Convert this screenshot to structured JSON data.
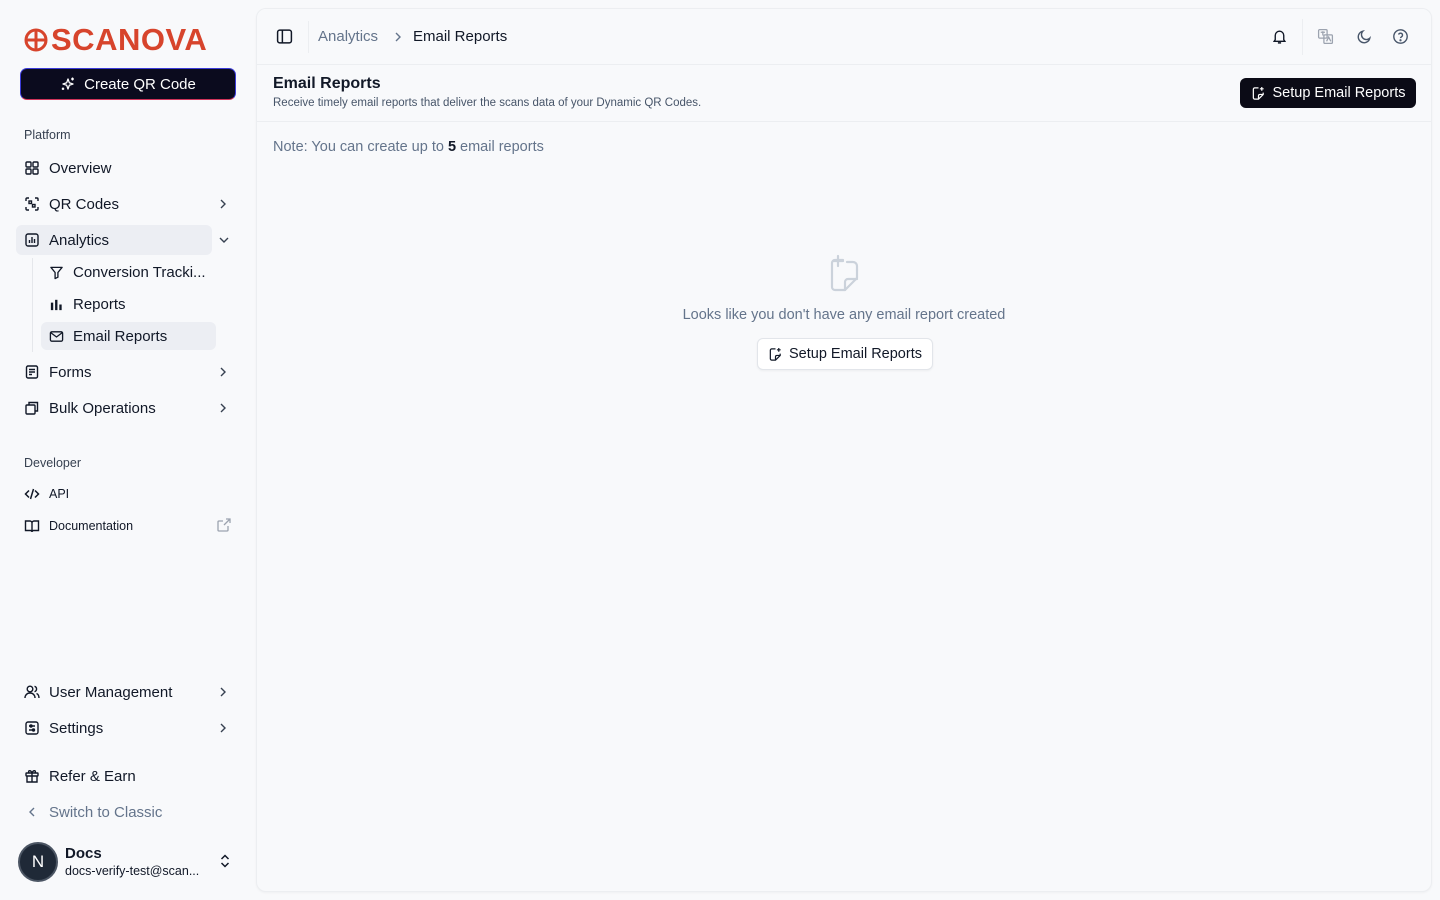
{
  "brand": {
    "name": "SCANOVA",
    "color": "#d7442c",
    "logo_icon": "scanova-target-icon"
  },
  "sidebar": {
    "create_button": "Create QR Code",
    "platform_label": "Platform",
    "developer_label": "Developer",
    "items": {
      "overview": "Overview",
      "qr_codes": "QR Codes",
      "analytics": "Analytics",
      "conversion": "Conversion Tracki...",
      "reports": "Reports",
      "email_reports": "Email Reports",
      "forms": "Forms",
      "bulk": "Bulk Operations",
      "api": "API",
      "docs": "Documentation",
      "user_mgmt": "User Management",
      "settings": "Settings",
      "refer": "Refer & Earn",
      "classic": "Switch to Classic"
    },
    "user": {
      "initial": "N",
      "name": "Docs",
      "email": "docs-verify-test@scan..."
    }
  },
  "topbar": {
    "breadcrumb": [
      "Analytics",
      "Email Reports"
    ],
    "icons": [
      "bell-icon",
      "translate-icon",
      "moon-icon",
      "help-icon"
    ]
  },
  "page": {
    "title": "Email Reports",
    "subtitle": "Receive timely email reports that deliver the scans data of your Dynamic QR Codes.",
    "setup_button": "Setup Email Reports",
    "note_prefix": "Note: You can create up to ",
    "note_count": "5",
    "note_suffix": " email reports",
    "empty_text": "Looks like you don't have any email report created",
    "empty_button": "Setup Email Reports"
  }
}
